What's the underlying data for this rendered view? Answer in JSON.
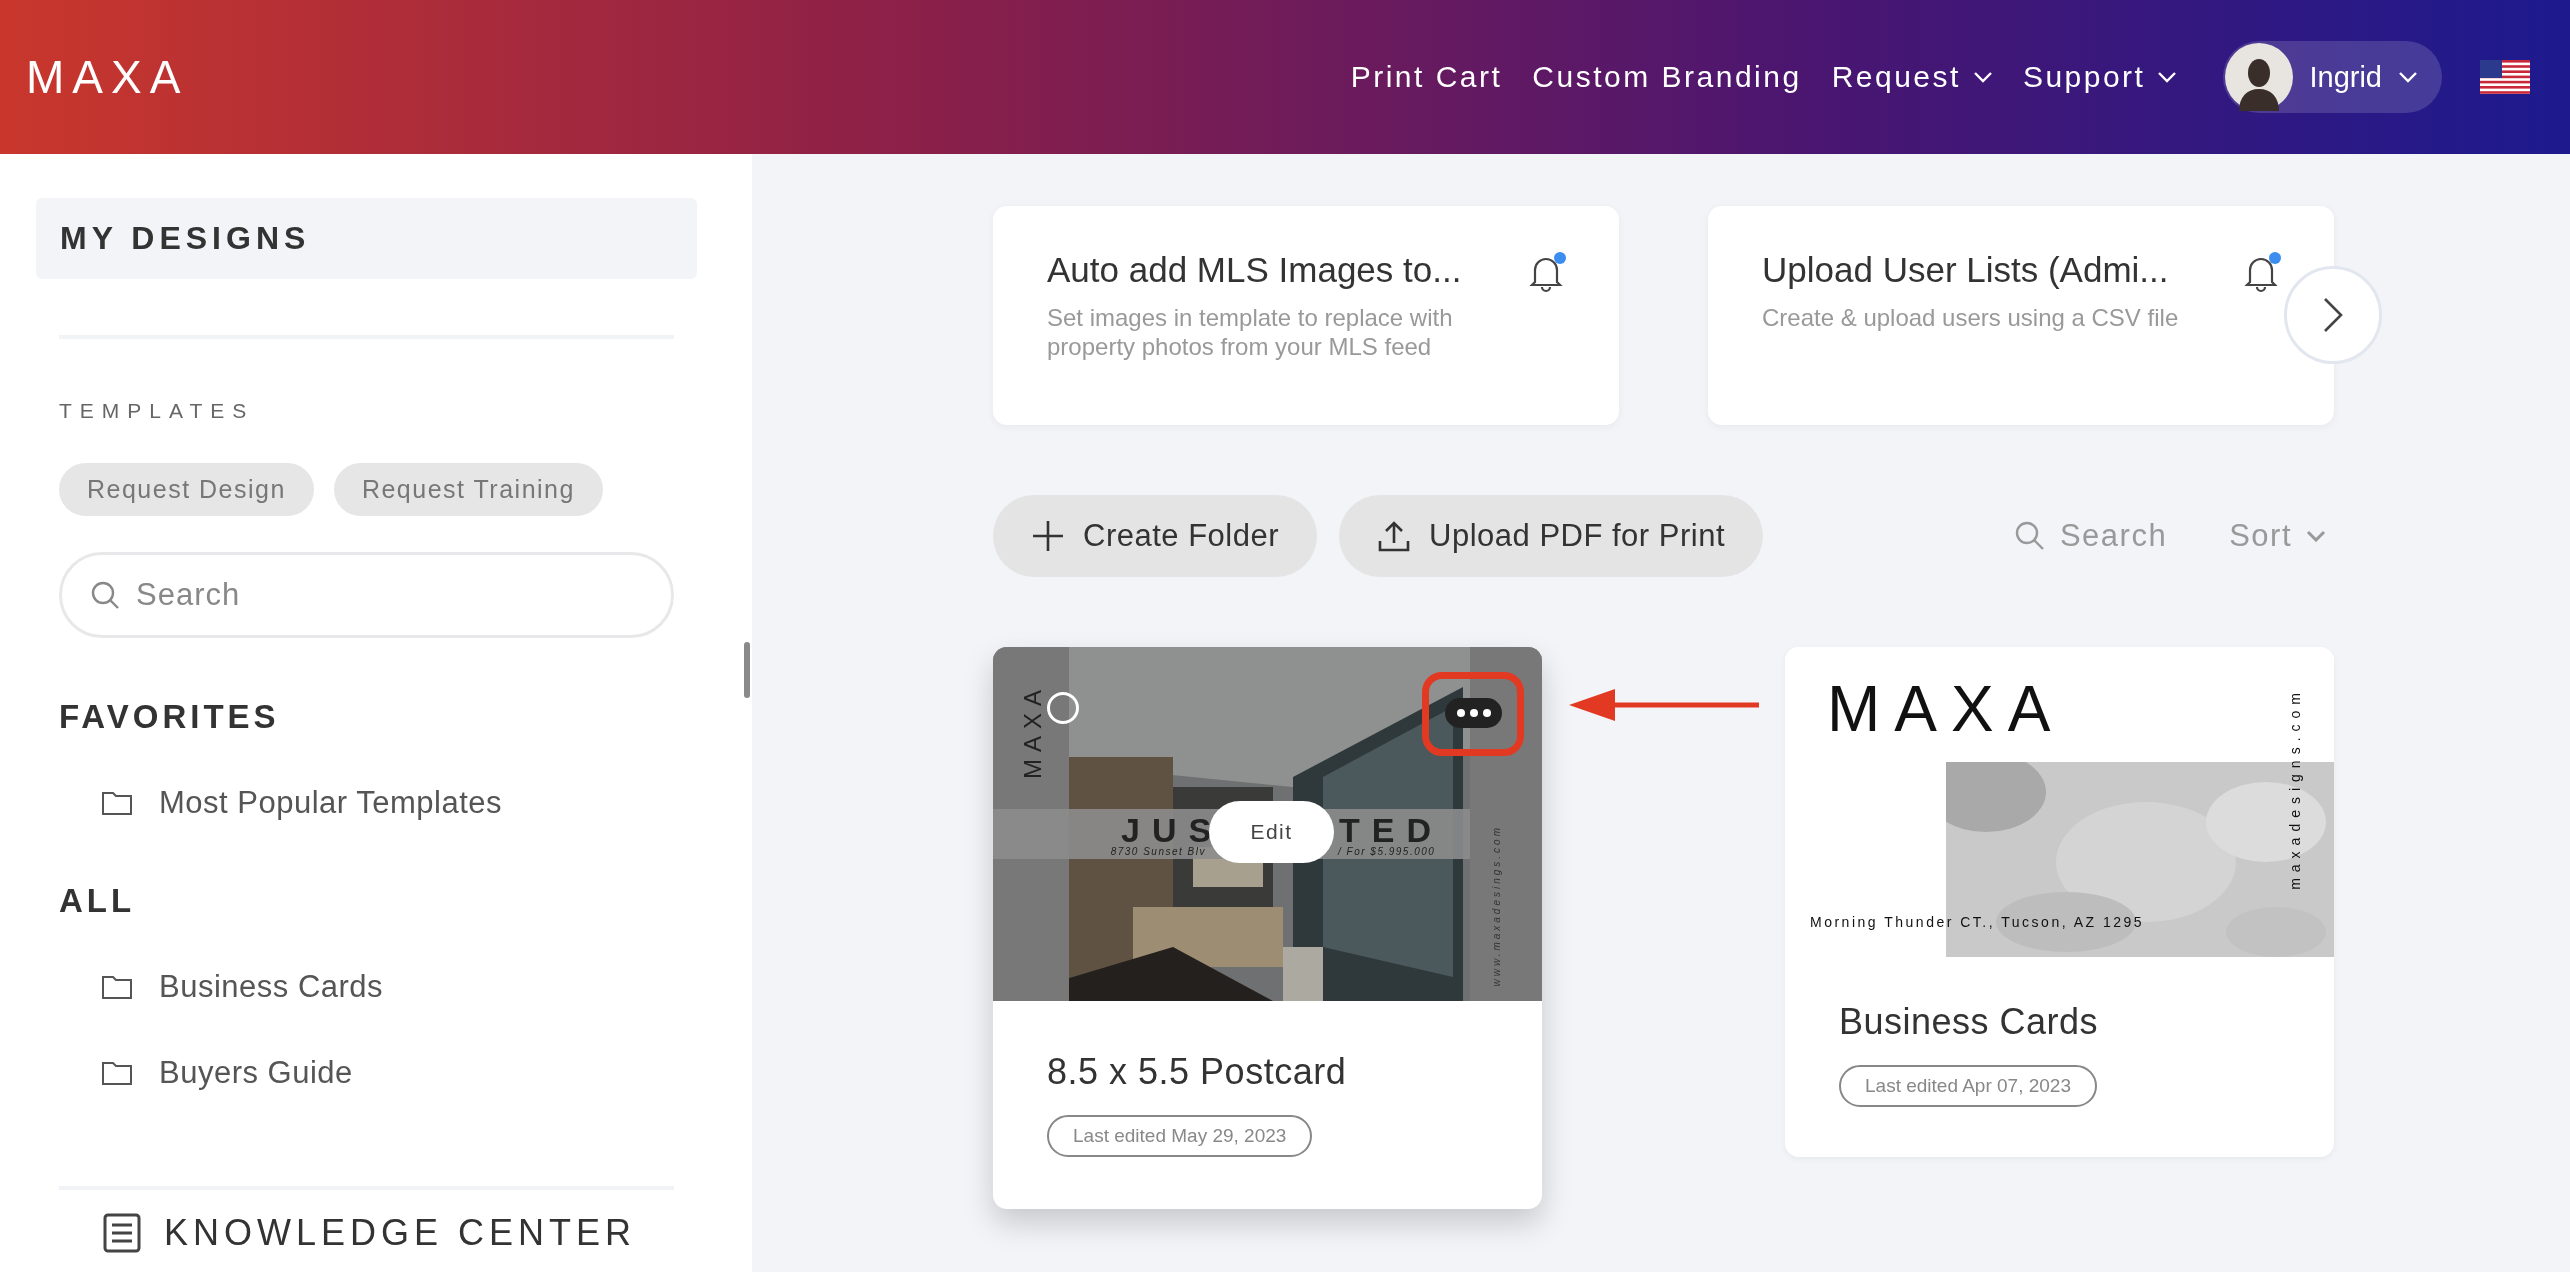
{
  "header": {
    "logo": "MAXA",
    "nav": [
      {
        "label": "Print Cart",
        "kind": "link"
      },
      {
        "label": "Custom Branding",
        "kind": "link"
      },
      {
        "label": "Request",
        "kind": "dropdown"
      },
      {
        "label": "Support",
        "kind": "dropdown"
      }
    ],
    "user": {
      "name": "Ingrid"
    }
  },
  "sidebar": {
    "title": "MY DESIGNS",
    "section": "TEMPLATES",
    "chips": [
      "Request Design",
      "Request Training"
    ],
    "search": {
      "placeholder": "Search"
    },
    "groups": [
      {
        "heading": "FAVORITES",
        "items": [
          "Most Popular Templates"
        ]
      },
      {
        "heading": "ALL",
        "items": [
          "Business Cards",
          "Buyers Guide"
        ]
      }
    ],
    "footer": "KNOWLEDGE CENTER"
  },
  "notifications": [
    {
      "title": "Auto add MLS Images to...",
      "text": "Set images in template to replace with property photos from your MLS feed",
      "unread": true
    },
    {
      "title": "Upload User Lists (Admi...",
      "text": "Create & upload users using a CSV file",
      "unread": true
    }
  ],
  "toolbar": {
    "buttons": [
      {
        "label": "Create Folder",
        "kind": "add"
      },
      {
        "label": "Upload PDF for Print",
        "kind": "upload"
      }
    ],
    "search": "Search",
    "sort": "Sort"
  },
  "designs": [
    {
      "kind": "postcard",
      "title": "8.5 x 5.5 Postcard",
      "edited": "Last edited May 29, 2023",
      "hovered": true,
      "selected": false,
      "edit": "Edit",
      "brand": "MAXA",
      "headline": [
        "JUS",
        "TED"
      ],
      "address": [
        "8730 Sunset Blv",
        "/ For $5.995.000"
      ],
      "website": "www.maxadesings.com"
    },
    {
      "kind": "business_card",
      "title": "Business Cards",
      "edited": "Last edited Apr 07, 2023",
      "hovered": false,
      "brand": "MAXA",
      "address": [
        "Morning Thunder CT., Tucson, AZ 1295"
      ],
      "website": "maxadesigns.com"
    }
  ]
}
